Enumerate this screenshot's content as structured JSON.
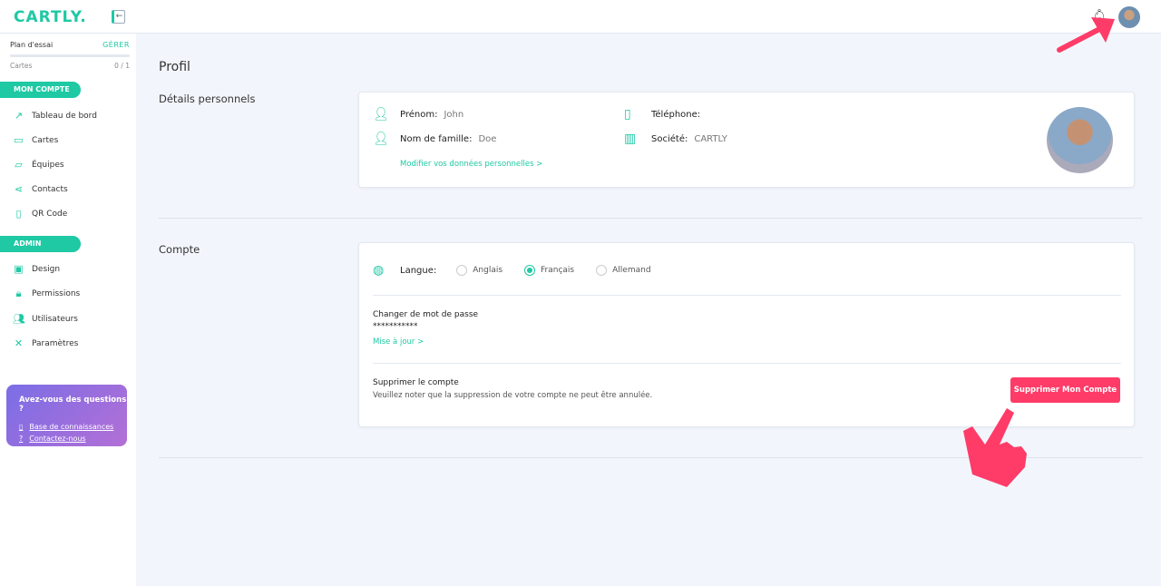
{
  "header": {
    "logo": "CARTLY."
  },
  "sidebar": {
    "plan": {
      "name": "Plan d'essai",
      "manage": "GÉRER",
      "cards_label": "Cartes",
      "cards_count": "0 / 1",
      "progress": 0
    },
    "section_account": "MON COMPTE",
    "account_items": [
      {
        "label": "Tableau de bord",
        "icon": "trending-up-icon"
      },
      {
        "label": "Cartes",
        "icon": "card-icon"
      },
      {
        "label": "Équipes",
        "icon": "folder-icon"
      },
      {
        "label": "Contacts",
        "icon": "share-icon"
      },
      {
        "label": "QR Code",
        "icon": "phone-icon"
      }
    ],
    "section_admin": "ADMIN",
    "admin_items": [
      {
        "label": "Design",
        "icon": "image-icon"
      },
      {
        "label": "Permissions",
        "icon": "lock-icon"
      },
      {
        "label": "Utilisateurs",
        "icon": "users-icon"
      },
      {
        "label": "Paramètres",
        "icon": "tools-icon"
      }
    ],
    "help": {
      "title": "Avez-vous des questions ?",
      "kb": "Base de connaissances",
      "contact": "Contactez-nous"
    }
  },
  "main": {
    "title": "Profil",
    "personal": {
      "heading": "Détails personnels",
      "first_name_label": "Prénom:",
      "first_name": "John",
      "last_name_label": "Nom de famille:",
      "last_name": "Doe",
      "phone_label": "Téléphone:",
      "phone": "",
      "company_label": "Société:",
      "company": "CARTLY",
      "edit_link": "Modifier vos données personnelles >"
    },
    "account": {
      "heading": "Compte",
      "language_label": "Langue:",
      "languages": [
        "Anglais",
        "Français",
        "Allemand"
      ],
      "selected_language": "Français",
      "password_label": "Changer de mot de passe",
      "password_mask": "***********",
      "update_link": "Mise à jour >",
      "delete_title": "Supprimer le compte",
      "delete_note": "Veuillez noter que la suppression de votre compte ne peut être annulée.",
      "delete_button": "Supprimer Mon Compte"
    }
  },
  "colors": {
    "accent": "#1ec9a4",
    "danger": "#ff3b68"
  }
}
